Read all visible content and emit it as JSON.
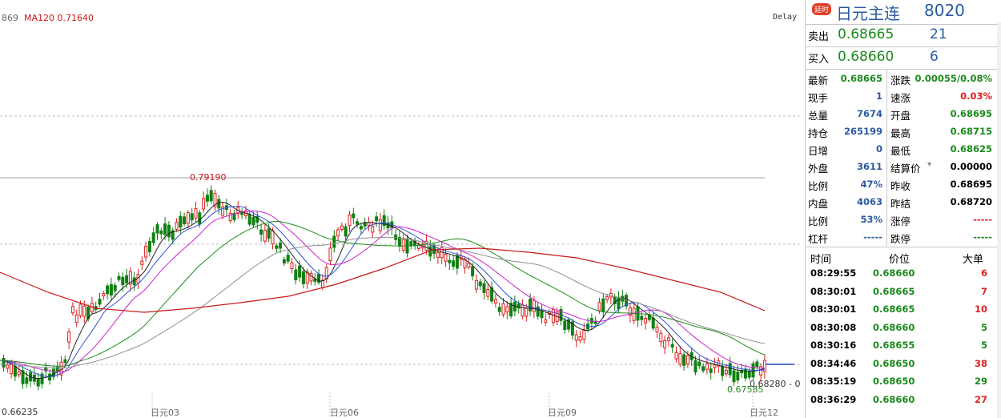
{
  "chart": {
    "left_value": "869",
    "ma120_label": "MA120 0.71640",
    "delay_label": "Delay",
    "high_label": "0.79190",
    "low_label": "0.66235",
    "recent_low_label": "0.67585",
    "price_tag": "0.68280 - 0.",
    "x_labels": [
      "日元03",
      "日元06",
      "日元09",
      "日元12"
    ],
    "colors": {
      "up": "#e02020",
      "down": "#108010",
      "ma_red": "#c81818",
      "ma_gray": "#909090",
      "ma_green": "#1e8c1e",
      "ma_magenta": "#d020d0",
      "ma_blue": "#3050e0",
      "ma_black": "#222222"
    }
  },
  "panel": {
    "delay_badge": "延时",
    "contract_name": "日元主连",
    "contract_code": "8020",
    "sell_label": "卖出",
    "sell_price": "0.68665",
    "sell_vol": "21",
    "buy_label": "买入",
    "buy_price": "0.68660",
    "buy_vol": "6"
  },
  "stats": [
    {
      "l": "最新",
      "lv": "0.68665",
      "lc": "#1a8a1a",
      "r": "涨跌",
      "rv": "0.00055/0.08%",
      "rc": "#1a8a1a"
    },
    {
      "l": "现手",
      "lv": "1",
      "lc": "#2a5aa0",
      "r": "速涨",
      "rv": "0.03%",
      "rc": "#e02020"
    },
    {
      "l": "总量",
      "lv": "7674",
      "lc": "#2a5aa0",
      "r": "开盘",
      "rv": "0.68695",
      "rc": "#1a8a1a"
    },
    {
      "l": "持仓",
      "lv": "265199",
      "lc": "#2a5aa0",
      "r": "最高",
      "rv": "0.68715",
      "rc": "#1a8a1a"
    },
    {
      "l": "日增",
      "lv": "0",
      "lc": "#2a5aa0",
      "r": "最低",
      "rv": "0.68625",
      "rc": "#1a8a1a"
    },
    {
      "l": "外盘",
      "lv": "3611",
      "lc": "#2a5aa0",
      "r": "结算价",
      "rv": "0.00000",
      "rc": "#000000"
    },
    {
      "l": "比例",
      "lv": "47%",
      "lc": "#2a5aa0",
      "r": "昨收",
      "rv": "0.68695",
      "rc": "#000000"
    },
    {
      "l": "内盘",
      "lv": "4063",
      "lc": "#2a5aa0",
      "r": "昨结",
      "rv": "0.68720",
      "rc": "#000000"
    },
    {
      "l": "比例",
      "lv": "53%",
      "lc": "#2a5aa0",
      "r": "涨停",
      "rv": "-----",
      "rc": "#e02020"
    },
    {
      "l": "杠杆",
      "lv": "-----",
      "lc": "#2a5aa0",
      "r": "跌停",
      "rv": "-----",
      "rc": "#1a8a1a"
    }
  ],
  "ticks_header": {
    "time": "时间",
    "price": "价位",
    "vol": "大单"
  },
  "ticks": [
    {
      "time": "08:29:55",
      "price": "0.68660",
      "vol": "6",
      "vc": "#e02020"
    },
    {
      "time": "08:30:01",
      "price": "0.68665",
      "vol": "7",
      "vc": "#e02020"
    },
    {
      "time": "08:30:01",
      "price": "0.68665",
      "vol": "10",
      "vc": "#e02020"
    },
    {
      "time": "08:30:08",
      "price": "0.68660",
      "vol": "5",
      "vc": "#1a8a1a"
    },
    {
      "time": "08:30:16",
      "price": "0.68655",
      "vol": "5",
      "vc": "#1a8a1a"
    },
    {
      "time": "08:34:46",
      "price": "0.68650",
      "vol": "38",
      "vc": "#e02020"
    },
    {
      "time": "08:35:19",
      "price": "0.68650",
      "vol": "29",
      "vc": "#1a8a1a"
    },
    {
      "time": "08:36:29",
      "price": "0.68660",
      "vol": "27",
      "vc": "#e02020"
    }
  ]
}
